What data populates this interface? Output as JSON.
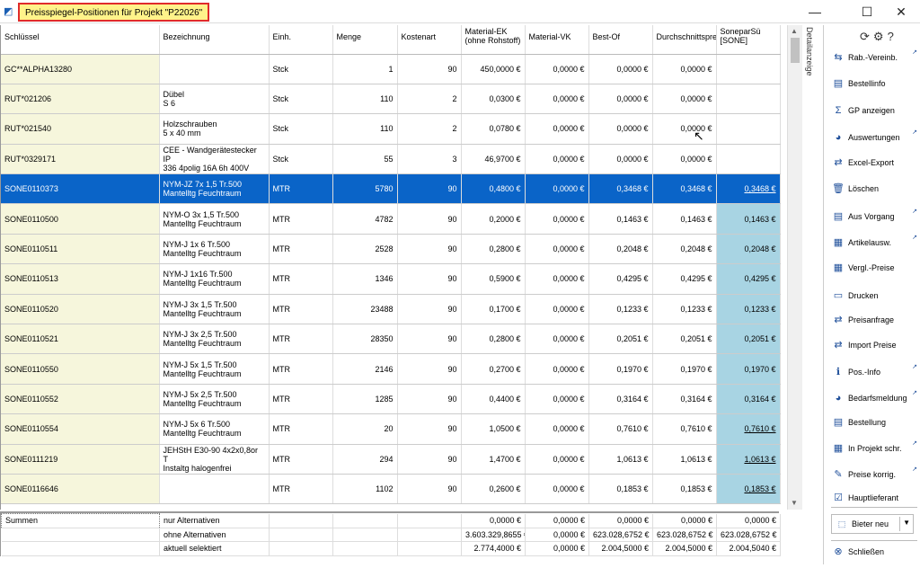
{
  "window": {
    "title": "Preisspiegel-Positionen für Projekt \"P22026\"",
    "minimize": "—",
    "maximize": "☐",
    "close": "✕"
  },
  "columns": [
    "Schlüssel",
    "Bezeichnung",
    "Einh.",
    "Menge",
    "Kostenart",
    "Material-EK (ohne Rohstoff)",
    "Material-VK",
    "Best-Of",
    "Durchschnittspreis",
    "SoneparSü [SONE]"
  ],
  "rows": [
    {
      "key": "GC**ALPHA13280",
      "desc1": "",
      "desc2": "",
      "unit": "Stck",
      "qty": "1",
      "cost": "90",
      "ek": "450,0000 €",
      "vk": "0,0000 €",
      "best": "0,0000 €",
      "avg": "0,0000 €",
      "sone": ""
    },
    {
      "key": "RUT*021206",
      "desc1": "Dübel",
      "desc2": "S  6",
      "unit": "Stck",
      "qty": "110",
      "cost": "2",
      "ek": "0,0300 €",
      "vk": "0,0000 €",
      "best": "0,0000 €",
      "avg": "0,0000 €",
      "sone": ""
    },
    {
      "key": "RUT*021540",
      "desc1": "Holzschrauben",
      "desc2": "5 x 40 mm",
      "unit": "Stck",
      "qty": "110",
      "cost": "2",
      "ek": "0,0780 €",
      "vk": "0,0000 €",
      "best": "0,0000 €",
      "avg": "0,0000 €",
      "sone": ""
    },
    {
      "key": "RUT*0329171",
      "desc1": "CEE - Wandgerätestecker IP",
      "desc2": "336  4polig 16A 6h 400V",
      "unit": "Stck",
      "qty": "55",
      "cost": "3",
      "ek": "46,9700 €",
      "vk": "0,0000 €",
      "best": "0,0000 €",
      "avg": "0,0000 €",
      "sone": ""
    },
    {
      "key": "SONE0110373",
      "desc1": "NYM-JZ  7x 1,5     Tr.500",
      "desc2": "Mantelltg Feuchtraum",
      "unit": "MTR",
      "qty": "5780",
      "cost": "90",
      "ek": "0,4800 €",
      "vk": "0,0000 €",
      "best": "0,3468 €",
      "avg": "0,3468 €",
      "sone": "0,3468 €"
    },
    {
      "key": "SONE0110500",
      "desc1": "NYM-O   3x 1,5     Tr.500",
      "desc2": "Mantelltg Feuchtraum",
      "unit": "MTR",
      "qty": "4782",
      "cost": "90",
      "ek": "0,2000 €",
      "vk": "0,0000 €",
      "best": "0,1463 €",
      "avg": "0,1463 €",
      "sone": "0,1463 €"
    },
    {
      "key": "SONE0110511",
      "desc1": "NYM-J   1x 6       Tr.500",
      "desc2": "Mantelltg Feuchtraum",
      "unit": "MTR",
      "qty": "2528",
      "cost": "90",
      "ek": "0,2800 €",
      "vk": "0,0000 €",
      "best": "0,2048 €",
      "avg": "0,2048 €",
      "sone": "0,2048 €"
    },
    {
      "key": "SONE0110513",
      "desc1": "NYM-J   1x16       Tr.500",
      "desc2": "Mantelltg Feuchtraum",
      "unit": "MTR",
      "qty": "1346",
      "cost": "90",
      "ek": "0,5900 €",
      "vk": "0,0000 €",
      "best": "0,4295 €",
      "avg": "0,4295 €",
      "sone": "0,4295 €"
    },
    {
      "key": "SONE0110520",
      "desc1": "NYM-J   3x 1,5     Tr.500",
      "desc2": "Mantelltg Feuchtraum",
      "unit": "MTR",
      "qty": "23488",
      "cost": "90",
      "ek": "0,1700 €",
      "vk": "0,0000 €",
      "best": "0,1233 €",
      "avg": "0,1233 €",
      "sone": "0,1233 €"
    },
    {
      "key": "SONE0110521",
      "desc1": "NYM-J   3x 2,5     Tr.500",
      "desc2": "Mantelltg Feuchtraum",
      "unit": "MTR",
      "qty": "28350",
      "cost": "90",
      "ek": "0,2800 €",
      "vk": "0,0000 €",
      "best": "0,2051 €",
      "avg": "0,2051 €",
      "sone": "0,2051 €"
    },
    {
      "key": "SONE0110550",
      "desc1": "NYM-J   5x 1,5     Tr.500",
      "desc2": "Mantelltg Feuchtraum",
      "unit": "MTR",
      "qty": "2146",
      "cost": "90",
      "ek": "0,2700 €",
      "vk": "0,0000 €",
      "best": "0,1970 €",
      "avg": "0,1970 €",
      "sone": "0,1970 €"
    },
    {
      "key": "SONE0110552",
      "desc1": "NYM-J   5x 2,5     Tr.500",
      "desc2": "Mantelltg Feuchtraum",
      "unit": "MTR",
      "qty": "1285",
      "cost": "90",
      "ek": "0,4400 €",
      "vk": "0,0000 €",
      "best": "0,3164 €",
      "avg": "0,3164 €",
      "sone": "0,3164 €"
    },
    {
      "key": "SONE0110554",
      "desc1": "NYM-J   5x 6       Tr.500",
      "desc2": "Mantelltg Feuchtraum",
      "unit": "MTR",
      "qty": "20",
      "cost": "90",
      "ek": "1,0500 €",
      "vk": "0,0000 €",
      "best": "0,7610 €",
      "avg": "0,7610 €",
      "sone": "0,7610 €"
    },
    {
      "key": "SONE0111219",
      "desc1": "JEHStH E30-90  4x2x0,8or T",
      "desc2": "Instaltg halogenfrei",
      "unit": "MTR",
      "qty": "294",
      "cost": "90",
      "ek": "1,4700 €",
      "vk": "0,0000 €",
      "best": "1,0613 €",
      "avg": "1,0613 €",
      "sone": "1,0613 €"
    },
    {
      "key": "SONE0116646",
      "desc1": "",
      "desc2": "",
      "unit": "MTR",
      "qty": "1102",
      "cost": "90",
      "ek": "0,2600 €",
      "vk": "0,0000 €",
      "best": "0,1853 €",
      "avg": "0,1853 €",
      "sone": "0,1853 €"
    }
  ],
  "summary": {
    "label": "Summen",
    "rows": [
      {
        "name": "nur Alternativen",
        "ek": "0,0000 €",
        "vk": "0,0000 €",
        "best": "0,0000 €",
        "avg": "0,0000 €",
        "sone": "0,0000 €"
      },
      {
        "name": "ohne Alternativen",
        "ek": "3.603.329,8655 €",
        "vk": "0,0000 €",
        "best": "623.028,6752 €",
        "avg": "623.028,6752 €",
        "sone": "623.028,6752 €"
      },
      {
        "name": "aktuell selektiert",
        "ek": "2.774,4000 €",
        "vk": "0,0000 €",
        "best": "2.004,5000 €",
        "avg": "2.004,5000 €",
        "sone": "2.004,5040 €"
      }
    ]
  },
  "detail_tab": "Detailanzeige",
  "panel": {
    "buttons": [
      {
        "label": "Rab.-Vereinb.",
        "icon": "agreement-icon",
        "glyph": "⇆",
        "ext": true
      },
      {
        "label": "Bestellinfo",
        "icon": "document-icon",
        "glyph": "▤",
        "ext": false
      },
      {
        "label": "GP anzeigen",
        "icon": "sum-icon",
        "glyph": "Σ",
        "ext": false
      },
      {
        "label": "Auswertungen",
        "icon": "chart-icon",
        "glyph": "◕",
        "ext": true
      },
      {
        "label": "Excel-Export",
        "icon": "export-icon",
        "glyph": "⇄",
        "ext": false
      },
      {
        "label": "Löschen",
        "icon": "trash-icon",
        "glyph": "🗑",
        "ext": false
      },
      {
        "label": "Aus Vorgang",
        "icon": "import-doc-icon",
        "glyph": "▤",
        "ext": true
      },
      {
        "label": "Artikelausw.",
        "icon": "article-icon",
        "glyph": "▦",
        "ext": true
      },
      {
        "label": "Vergl.-Preise",
        "icon": "compare-icon",
        "glyph": "▦",
        "ext": false
      },
      {
        "label": "Drucken",
        "icon": "print-icon",
        "glyph": "▭",
        "ext": false
      },
      {
        "label": "Preisanfrage",
        "icon": "request-icon",
        "glyph": "⇄",
        "ext": false
      },
      {
        "label": "Import Preise",
        "icon": "import-icon",
        "glyph": "⇄",
        "ext": false
      },
      {
        "label": "Pos.-Info",
        "icon": "info-icon",
        "glyph": "ℹ",
        "ext": true
      },
      {
        "label": "Bedarfsmeldung",
        "icon": "demand-icon",
        "glyph": "◕",
        "ext": true
      },
      {
        "label": "Bestellung",
        "icon": "order-icon",
        "glyph": "▤",
        "ext": false
      },
      {
        "label": "In Projekt schr.",
        "icon": "project-icon",
        "glyph": "▦",
        "ext": true
      },
      {
        "label": "Preise korrig.",
        "icon": "correct-icon",
        "glyph": "✎",
        "ext": true
      },
      {
        "label": "Hauptlieferant",
        "icon": "supplier-icon",
        "glyph": "☑",
        "ext": false
      }
    ],
    "bieter": "Bieter neu",
    "close": "Schließen"
  }
}
